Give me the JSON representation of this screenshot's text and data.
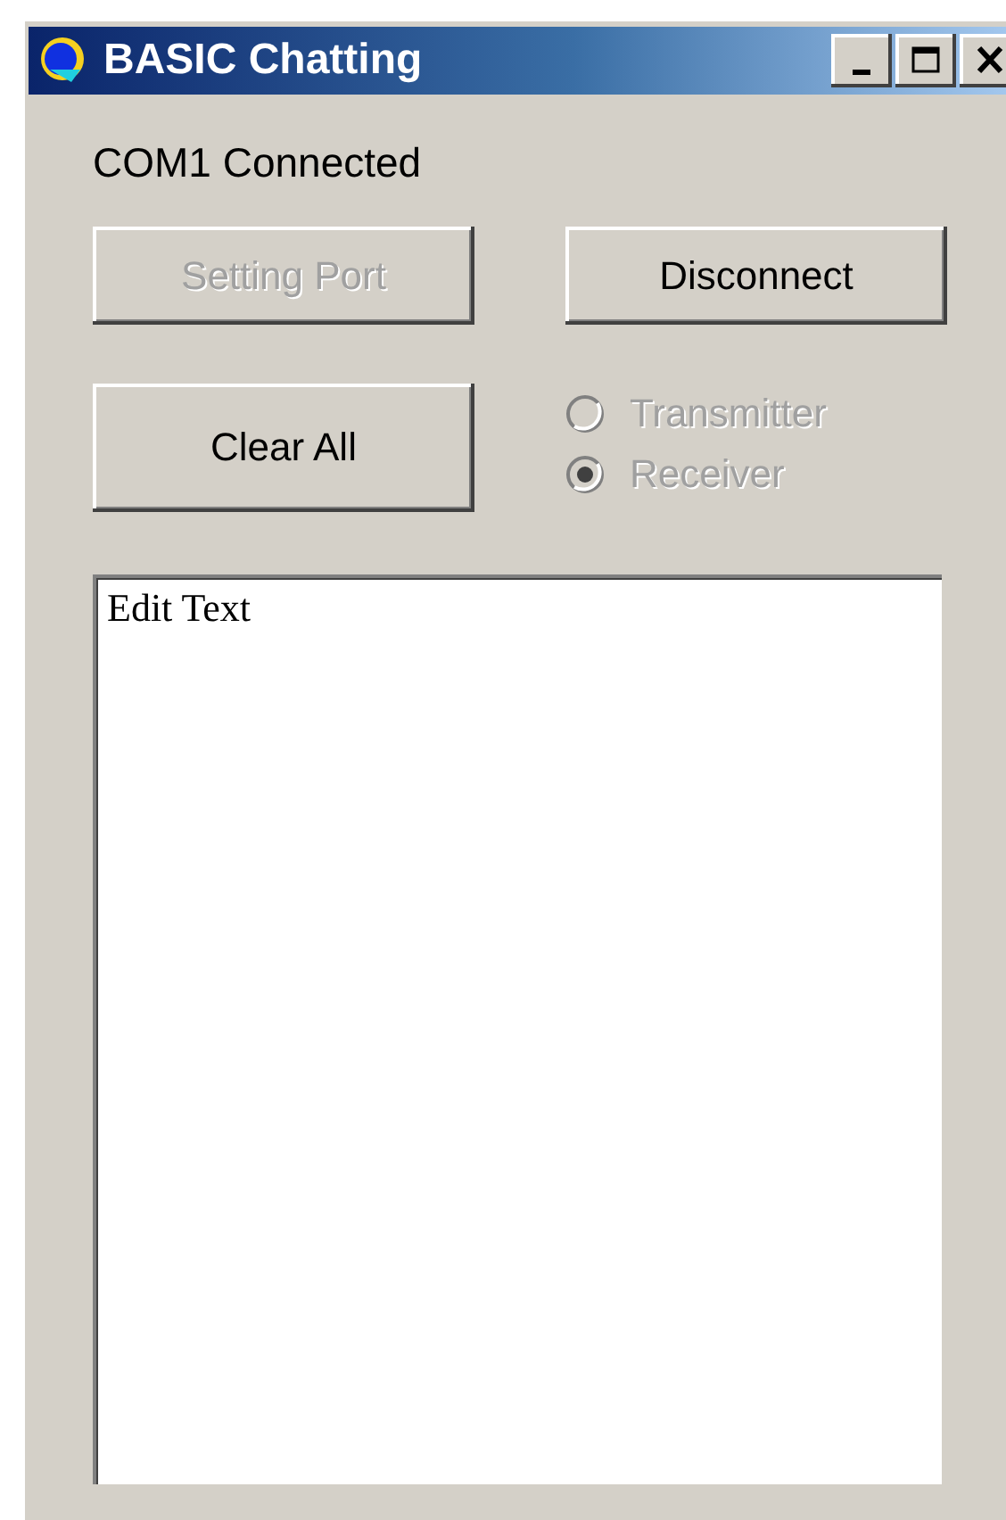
{
  "window": {
    "title": "BASIC Chatting"
  },
  "title_buttons": [
    {
      "kind": "minimize"
    },
    {
      "kind": "maximize"
    },
    {
      "kind": "close"
    }
  ],
  "status": "COM1 Connected",
  "buttons": [
    {
      "label": "Setting Port",
      "disabled": true
    },
    {
      "label": "Disconnect",
      "disabled": false
    },
    {
      "label": "Clear All",
      "disabled": false
    }
  ],
  "radios": [
    {
      "label": "Transmitter",
      "selected": false,
      "disabled": true
    },
    {
      "label": "Receiver",
      "selected": true,
      "disabled": true
    }
  ],
  "editor": {
    "value": "Edit Text"
  }
}
